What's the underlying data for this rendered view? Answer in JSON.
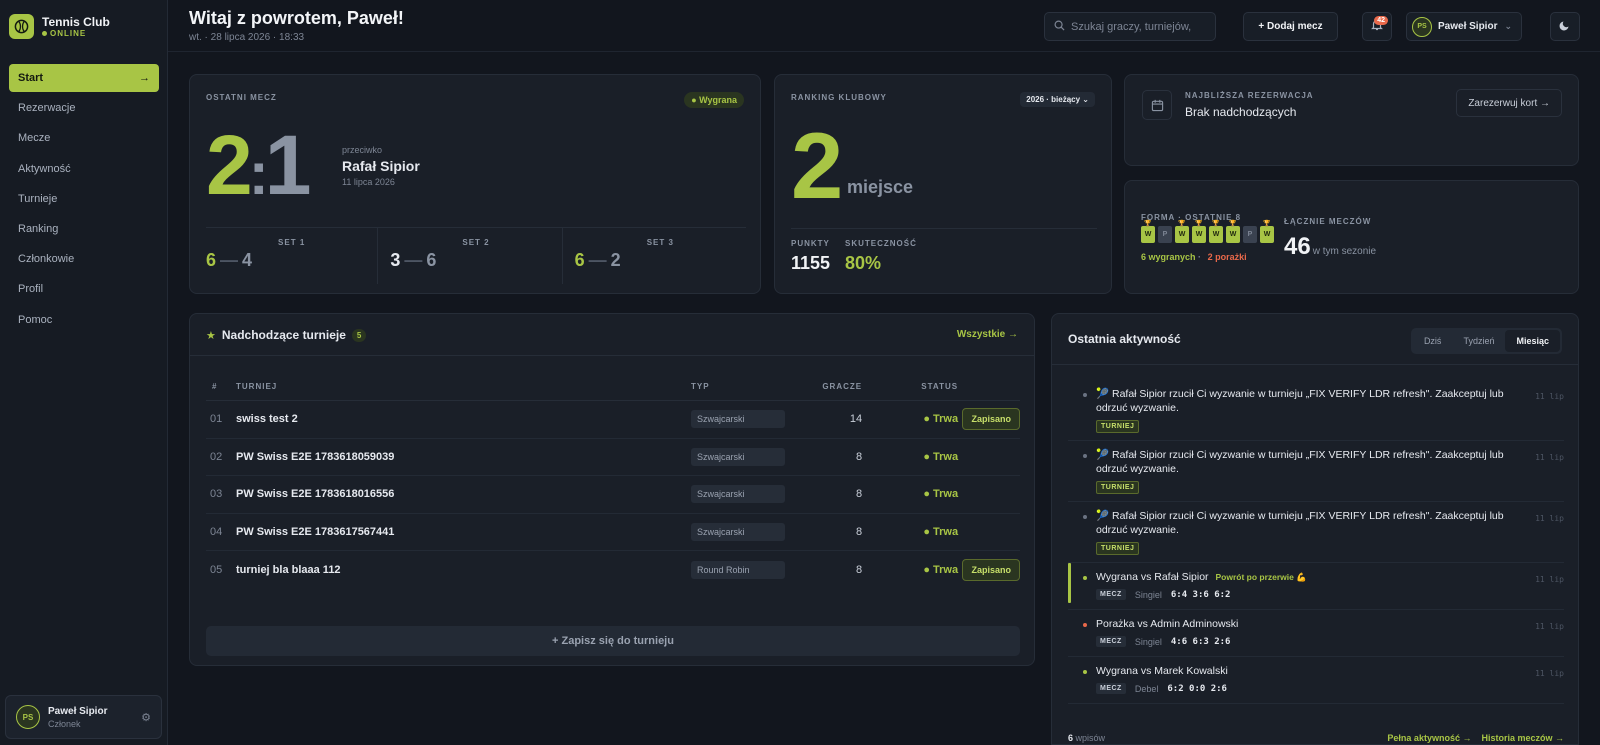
{
  "app": {
    "name": "Tennis Club",
    "status": "ONLINE"
  },
  "sidebar": {
    "items": [
      {
        "label": "Start",
        "active": true
      },
      {
        "label": "Rezerwacje"
      },
      {
        "label": "Mecze"
      },
      {
        "label": "Aktywność"
      },
      {
        "label": "Turnieje"
      },
      {
        "label": "Ranking"
      },
      {
        "label": "Członkowie"
      },
      {
        "label": "Profil"
      },
      {
        "label": "Pomoc"
      }
    ],
    "active_arrow": "→",
    "user": {
      "initials": "PS",
      "name": "Paweł Sipior",
      "role": "Członek"
    }
  },
  "header": {
    "greeting": "Witaj z powrotem, Paweł!",
    "date": "wt. · 28 lipca 2026 · 18:33",
    "search_placeholder": "Szukaj graczy, turniejów,",
    "add_match": "+ Dodaj mecz",
    "notifications": "42",
    "user_initials": "PS",
    "user_name": "Paweł Sipior"
  },
  "last_match": {
    "label": "OSTATNI MECZ",
    "result": "● Wygrana",
    "score_a": "2",
    "score_b": "1",
    "vs_label": "przeciwko",
    "opponent": "Rafał Sipior",
    "date": "11 lipca 2026",
    "sets": [
      {
        "label": "SET 1",
        "a": "6",
        "b": "4"
      },
      {
        "label": "SET 2",
        "a": "3",
        "b": "6"
      },
      {
        "label": "SET 3",
        "a": "6",
        "b": "2"
      }
    ]
  },
  "ranking": {
    "label": "RANKING KLUBOWY",
    "season": "2026 · bieżący",
    "place": "2",
    "place_word": "miejsce",
    "points_label": "PUNKTY",
    "points": "1155",
    "eff_label": "SKUTECZNOŚĆ",
    "eff": "80%"
  },
  "reservation": {
    "label": "NAJBLIŻSZA REZERWACJA",
    "value": "Brak nadchodzących",
    "button": "Zarezerwuj kort →"
  },
  "form": {
    "label": "FORMA · OSTATNIE 8",
    "results": [
      "W",
      "P",
      "W",
      "W",
      "W",
      "W",
      "P",
      "W"
    ],
    "wins_text": "6 wygranych",
    "sep": "·",
    "losses_text": "2 porażki",
    "total_label": "ŁĄCZNIE MECZÓW",
    "total": "46",
    "total_suffix": "w tym sezonie"
  },
  "tournaments": {
    "title": "Nadchodzące turnieje",
    "count": "5",
    "all_link": "Wszystkie →",
    "headers": {
      "num": "#",
      "name": "TURNIEJ",
      "type": "TYP",
      "players": "GRACZE",
      "status": "STATUS"
    },
    "rows": [
      {
        "num": "01",
        "name": "swiss test 2",
        "type": "Szwajcarski",
        "players": "14",
        "status": "● Trwa",
        "action": "Zapisano"
      },
      {
        "num": "02",
        "name": "PW Swiss E2E 1783618059039",
        "type": "Szwajcarski",
        "players": "8",
        "status": "● Trwa",
        "action": ""
      },
      {
        "num": "03",
        "name": "PW Swiss E2E 1783618016556",
        "type": "Szwajcarski",
        "players": "8",
        "status": "● Trwa",
        "action": ""
      },
      {
        "num": "04",
        "name": "PW Swiss E2E 1783617567441",
        "type": "Szwajcarski",
        "players": "8",
        "status": "● Trwa",
        "action": ""
      },
      {
        "num": "05",
        "name": "turniej bla blaaa 112",
        "type": "Round Robin",
        "players": "8",
        "status": "● Trwa",
        "action": "Zapisano"
      }
    ],
    "join_button": "+ Zapisz się do turnieju"
  },
  "activity": {
    "title": "Ostatnia aktywność",
    "tabs": [
      "Dziś",
      "Tydzień",
      "Miesiąc"
    ],
    "active_tab": "Miesiąc",
    "items": [
      {
        "text": "🎾 Rafał Sipior rzucił Ci wyzwanie w turnieju „FIX VERIFY LDR refresh\". Zaakceptuj lub odrzuć wyzwanie.",
        "tag": "TURNIEJ",
        "time": "11 lip"
      },
      {
        "text": "🎾 Rafał Sipior rzucił Ci wyzwanie w turnieju „FIX VERIFY LDR refresh\". Zaakceptuj lub odrzuć wyzwanie.",
        "tag": "TURNIEJ",
        "time": "11 lip"
      },
      {
        "text": "🎾 Rafał Sipior rzucił Ci wyzwanie w turnieju „FIX VERIFY LDR refresh\". Zaakceptuj lub odrzuć wyzwanie.",
        "tag": "TURNIEJ",
        "time": "11 lip"
      },
      {
        "text": "Wygrana vs Rafał Sipior",
        "badge": "Powrót po przerwie 💪",
        "tag": "MECZ",
        "kind": "Singiel",
        "score": "6:4 3:6 6:2",
        "time": "11 lip",
        "color": "#a8c545"
      },
      {
        "text": "Porażka vs Admin Adminowski",
        "tag": "MECZ",
        "kind": "Singiel",
        "score": "4:6 6:3 2:6",
        "time": "11 lip",
        "color": "#e8684a"
      },
      {
        "text": "Wygrana vs Marek Kowalski",
        "tag": "MECZ",
        "kind": "Debel",
        "score": "6:2 0:0 2:6",
        "time": "11 lip",
        "color": "#a8c545"
      }
    ],
    "footer_count": "6",
    "footer_word": "wpisów",
    "link_full": "Pełna aktywność →",
    "link_history": "Historia meczów →"
  },
  "colors": {
    "accent": "#a8c545",
    "loss": "#e8684a",
    "background": "#12161e",
    "card": "#1a1f28"
  }
}
